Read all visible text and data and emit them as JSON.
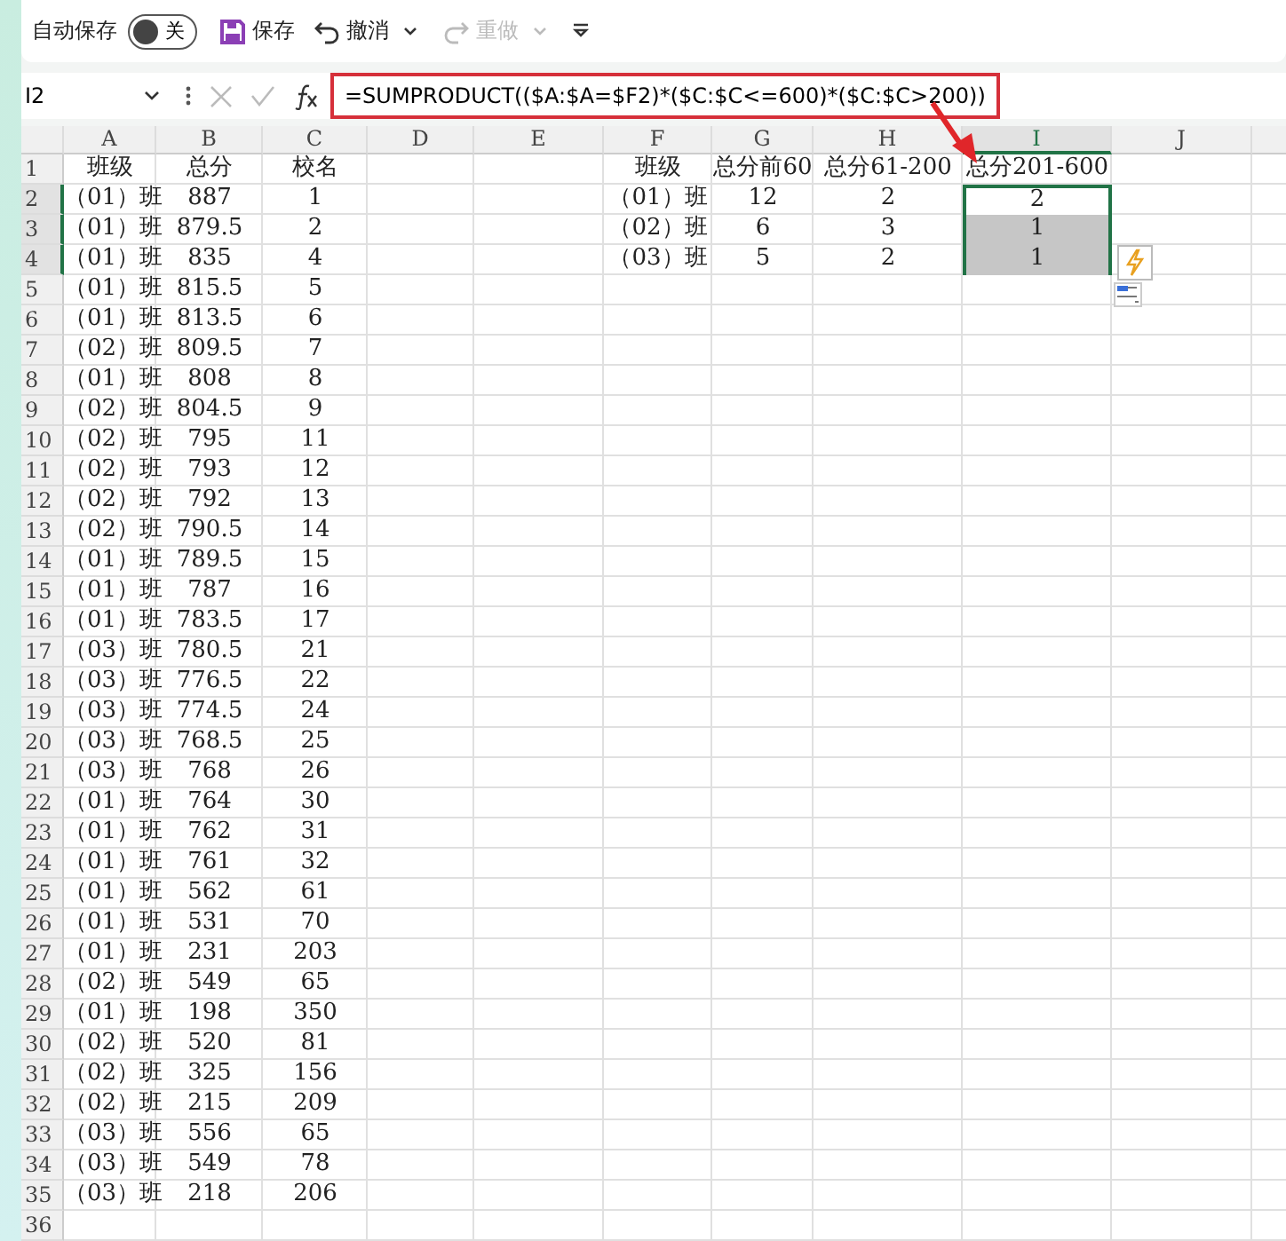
{
  "toolbar": {
    "autosave": {
      "label": "自动保存",
      "on": false,
      "state_text": "关"
    },
    "save": "保存",
    "undo": "撤消",
    "redo": {
      "label": "重做",
      "disabled": true
    }
  },
  "formula_bar": {
    "name_box": "I2",
    "formula": "=SUMPRODUCT(($A:$A=$F2)*($C:$C<=600)*($C:$C>200))"
  },
  "sheet": {
    "columns": [
      {
        "label": "A",
        "selected": false
      },
      {
        "label": "B",
        "selected": false
      },
      {
        "label": "C",
        "selected": false
      },
      {
        "label": "D",
        "selected": false
      },
      {
        "label": "E",
        "selected": false
      },
      {
        "label": "F",
        "selected": false
      },
      {
        "label": "G",
        "selected": false
      },
      {
        "label": "H",
        "selected": false
      },
      {
        "label": "I",
        "selected": true
      },
      {
        "label": "J",
        "selected": false
      }
    ],
    "rows": [
      {
        "number": "1",
        "selected": false,
        "cells": {
          "A": "班级",
          "B": "总分",
          "C": "校名",
          "F": "班级",
          "G": "总分前60",
          "H": "总分61-200",
          "I": {
            "text": "总分201-600",
            "selected": false,
            "active": false
          }
        }
      },
      {
        "number": "2",
        "selected": true,
        "cells": {
          "A": "（01）班",
          "B": "887",
          "C": "1",
          "F": "（01）班",
          "G": "12",
          "H": "2",
          "I": {
            "text": "2",
            "selected": true,
            "active": true
          }
        }
      },
      {
        "number": "3",
        "selected": true,
        "cells": {
          "A": "（01）班",
          "B": "879.5",
          "C": "2",
          "F": "（02）班",
          "G": "6",
          "H": "3",
          "I": {
            "text": "1",
            "selected": true,
            "active": false
          }
        }
      },
      {
        "number": "4",
        "selected": true,
        "cells": {
          "A": "（01）班",
          "B": "835",
          "C": "4",
          "F": "（03）班",
          "G": "5",
          "H": "2",
          "I": {
            "text": "1",
            "selected": true,
            "active": false
          }
        }
      },
      {
        "number": "5",
        "selected": false,
        "cells": {
          "A": "（01）班",
          "B": "815.5",
          "C": "5"
        }
      },
      {
        "number": "6",
        "selected": false,
        "cells": {
          "A": "（01）班",
          "B": "813.5",
          "C": "6"
        }
      },
      {
        "number": "7",
        "selected": false,
        "cells": {
          "A": "（02）班",
          "B": "809.5",
          "C": "7"
        }
      },
      {
        "number": "8",
        "selected": false,
        "cells": {
          "A": "（01）班",
          "B": "808",
          "C": "8"
        }
      },
      {
        "number": "9",
        "selected": false,
        "cells": {
          "A": "（02）班",
          "B": "804.5",
          "C": "9"
        }
      },
      {
        "number": "10",
        "selected": false,
        "cells": {
          "A": "（02）班",
          "B": "795",
          "C": "11"
        }
      },
      {
        "number": "11",
        "selected": false,
        "cells": {
          "A": "（02）班",
          "B": "793",
          "C": "12"
        }
      },
      {
        "number": "12",
        "selected": false,
        "cells": {
          "A": "（02）班",
          "B": "792",
          "C": "13"
        }
      },
      {
        "number": "13",
        "selected": false,
        "cells": {
          "A": "（02）班",
          "B": "790.5",
          "C": "14"
        }
      },
      {
        "number": "14",
        "selected": false,
        "cells": {
          "A": "（01）班",
          "B": "789.5",
          "C": "15"
        }
      },
      {
        "number": "15",
        "selected": false,
        "cells": {
          "A": "（01）班",
          "B": "787",
          "C": "16"
        }
      },
      {
        "number": "16",
        "selected": false,
        "cells": {
          "A": "（01）班",
          "B": "783.5",
          "C": "17"
        }
      },
      {
        "number": "17",
        "selected": false,
        "cells": {
          "A": "（03）班",
          "B": "780.5",
          "C": "21"
        }
      },
      {
        "number": "18",
        "selected": false,
        "cells": {
          "A": "（03）班",
          "B": "776.5",
          "C": "22"
        }
      },
      {
        "number": "19",
        "selected": false,
        "cells": {
          "A": "（03）班",
          "B": "774.5",
          "C": "24"
        }
      },
      {
        "number": "20",
        "selected": false,
        "cells": {
          "A": "（03）班",
          "B": "768.5",
          "C": "25"
        }
      },
      {
        "number": "21",
        "selected": false,
        "cells": {
          "A": "（03）班",
          "B": "768",
          "C": "26"
        }
      },
      {
        "number": "22",
        "selected": false,
        "cells": {
          "A": "（01）班",
          "B": "764",
          "C": "30"
        }
      },
      {
        "number": "23",
        "selected": false,
        "cells": {
          "A": "（01）班",
          "B": "762",
          "C": "31"
        }
      },
      {
        "number": "24",
        "selected": false,
        "cells": {
          "A": "（01）班",
          "B": "761",
          "C": "32"
        }
      },
      {
        "number": "25",
        "selected": false,
        "cells": {
          "A": "（01）班",
          "B": "562",
          "C": "61"
        }
      },
      {
        "number": "26",
        "selected": false,
        "cells": {
          "A": "（01）班",
          "B": "531",
          "C": "70"
        }
      },
      {
        "number": "27",
        "selected": false,
        "cells": {
          "A": "（01）班",
          "B": "231",
          "C": "203"
        }
      },
      {
        "number": "28",
        "selected": false,
        "cells": {
          "A": "（02）班",
          "B": "549",
          "C": "65"
        }
      },
      {
        "number": "29",
        "selected": false,
        "cells": {
          "A": "（01）班",
          "B": "198",
          "C": "350"
        }
      },
      {
        "number": "30",
        "selected": false,
        "cells": {
          "A": "（02）班",
          "B": "520",
          "C": "81"
        }
      },
      {
        "number": "31",
        "selected": false,
        "cells": {
          "A": "（02）班",
          "B": "325",
          "C": "156"
        }
      },
      {
        "number": "32",
        "selected": false,
        "cells": {
          "A": "（02）班",
          "B": "215",
          "C": "209"
        }
      },
      {
        "number": "33",
        "selected": false,
        "cells": {
          "A": "（03）班",
          "B": "556",
          "C": "65"
        }
      },
      {
        "number": "34",
        "selected": false,
        "cells": {
          "A": "（03）班",
          "B": "549",
          "C": "78"
        }
      },
      {
        "number": "35",
        "selected": false,
        "cells": {
          "A": "（03）班",
          "B": "218",
          "C": "206"
        }
      },
      {
        "number": "36",
        "selected": false,
        "cells": {}
      }
    ]
  }
}
